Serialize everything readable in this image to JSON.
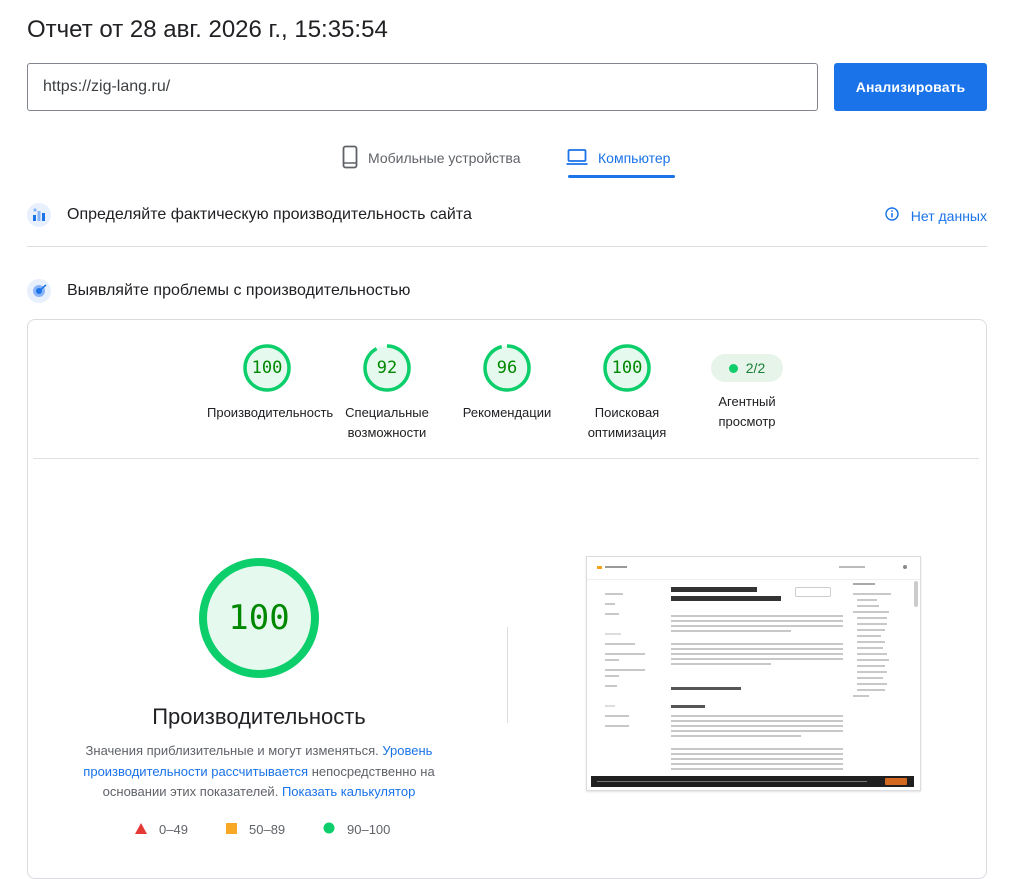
{
  "report": {
    "title": "Отчет от 28 авг. 2026 г., 15:35:54"
  },
  "search": {
    "url": "https://zig-lang.ru/",
    "analyze_label": "Анализировать"
  },
  "tabs": [
    {
      "label": "Мобильные устройства",
      "icon": "phone-icon",
      "active": false
    },
    {
      "label": "Компьютер",
      "icon": "laptop-icon",
      "active": true
    }
  ],
  "field_data": {
    "title": "Определяйте фактическую производительность сайта",
    "status": "Нет данных"
  },
  "lab_data": {
    "title": "Выявляйте проблемы с производительностью"
  },
  "scores": [
    {
      "value": "100",
      "score": 100,
      "label": "Производительность"
    },
    {
      "value": "92",
      "score": 92,
      "label": "Специальные возможности"
    },
    {
      "value": "96",
      "score": 96,
      "label": "Рекомендации"
    },
    {
      "value": "100",
      "score": 100,
      "label": "Поисковая оптимизация"
    }
  ],
  "agent": {
    "value": "2/2",
    "label": "Агентный просмотр"
  },
  "performance": {
    "score": "100",
    "title": "Производительность",
    "desc_start": "Значения приблизительные и могут изменяться.",
    "desc_link1": "Уровень производительности рассчитывается",
    "desc_mid": "непосредственно на основании этих показателей.",
    "desc_link2": "Показать калькулятор"
  },
  "legend": [
    {
      "range": "0–49",
      "color": "#e53935"
    },
    {
      "range": "50–89",
      "color": "#f9a825"
    },
    {
      "range": "90–100",
      "color": "#0cce6b"
    }
  ],
  "colors": {
    "accent": "#1a73e8",
    "pass": "#0cce6b",
    "pass_text": "#008800"
  }
}
